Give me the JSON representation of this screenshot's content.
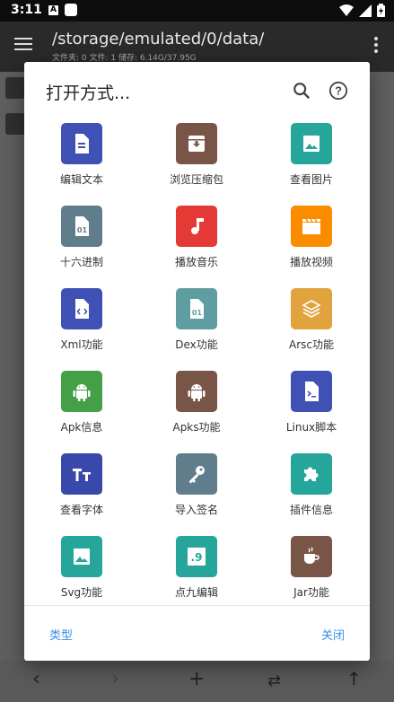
{
  "status_bar": {
    "time": "3:11",
    "icon_a": "A"
  },
  "app_bar": {
    "path": "/storage/emulated/0/data/",
    "subtitle": "文件夹: 0  文件: 1  储存: 6.14G/37.95G"
  },
  "dialog": {
    "title": "打开方式...",
    "items": [
      {
        "label": "编辑文本",
        "icon": "text-document-icon",
        "color": "#3f51b5"
      },
      {
        "label": "浏览压缩包",
        "icon": "archive-icon",
        "color": "#795548"
      },
      {
        "label": "查看图片",
        "icon": "image-icon",
        "color": "#26a69a"
      },
      {
        "label": "十六进制",
        "icon": "hex-file-icon",
        "color": "#607d8b"
      },
      {
        "label": "播放音乐",
        "icon": "music-note-icon",
        "color": "#e53935"
      },
      {
        "label": "播放视频",
        "icon": "video-clapper-icon",
        "color": "#fb8c00"
      },
      {
        "label": "Xml功能",
        "icon": "code-file-icon",
        "color": "#3f51b5"
      },
      {
        "label": "Dex功能",
        "icon": "dex-file-icon",
        "color": "#5f9ea0"
      },
      {
        "label": "Arsc功能",
        "icon": "layers-icon",
        "color": "#e0a33e"
      },
      {
        "label": "Apk信息",
        "icon": "android-icon",
        "color": "#43a047"
      },
      {
        "label": "Apks功能",
        "icon": "android-icon",
        "color": "#795548"
      },
      {
        "label": "Linux脚本",
        "icon": "terminal-file-icon",
        "color": "#3f51b5"
      },
      {
        "label": "查看字体",
        "icon": "font-icon",
        "color": "#3949ab"
      },
      {
        "label": "导入签名",
        "icon": "key-icon",
        "color": "#607d8b"
      },
      {
        "label": "插件信息",
        "icon": "puzzle-icon",
        "color": "#26a69a"
      },
      {
        "label": "Svg功能",
        "icon": "image-icon",
        "color": "#26a69a"
      },
      {
        "label": "点九编辑",
        "icon": "nine-patch-icon",
        "color": "#26a69a"
      },
      {
        "label": "Jar功能",
        "icon": "coffee-cup-icon",
        "color": "#795548"
      }
    ],
    "footer": {
      "left_button": "类型",
      "right_button": "关闭"
    }
  }
}
